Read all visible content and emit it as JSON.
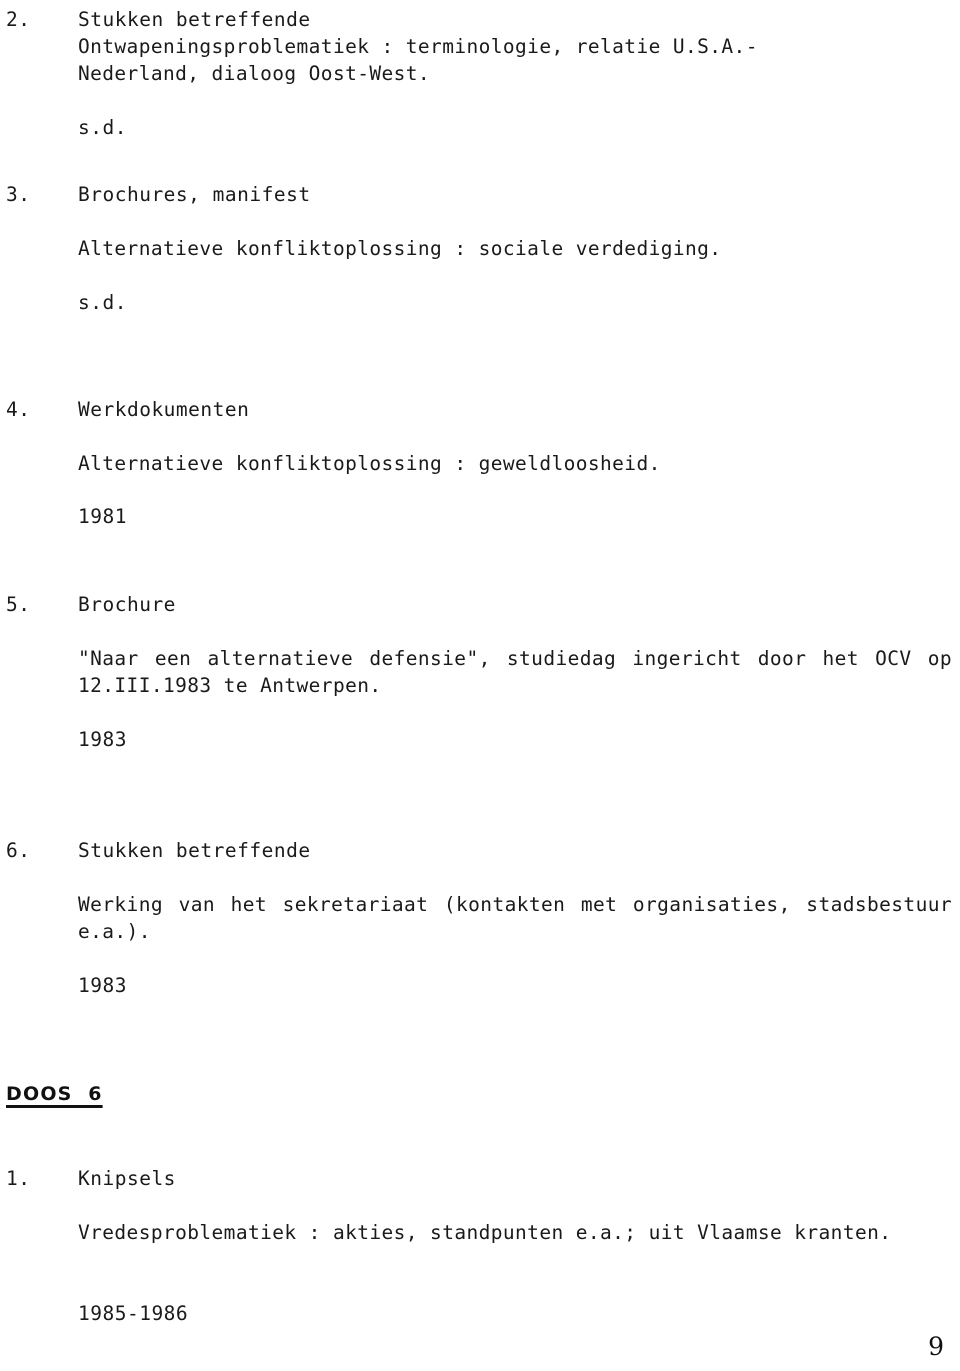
{
  "document": {
    "language": "nl",
    "folio": "9"
  },
  "entries": [
    {
      "number": "2.",
      "title": "Stukken betreffende",
      "description": "Ontwapeningsproblematiek : terminologie, relatie U.S.A.-\nNederland, dialoog Oost-West.",
      "date": "s.d."
    },
    {
      "number": "3.",
      "title": "Brochures, manifest",
      "description": "Alternatieve konfliktoplossing : sociale verdediging.",
      "date": "s.d."
    },
    {
      "number": "4.",
      "title": "Werkdokumenten",
      "description": "Alternatieve konfliktoplossing : geweldloosheid.",
      "date": "1981"
    },
    {
      "number": "5.",
      "title": "Brochure",
      "description": "\"Naar een alternatieve defensie\", studiedag ingericht door het OCV op 12.III.1983 te Antwerpen.",
      "date": "1983"
    },
    {
      "number": "6.",
      "title": "Stukken betreffende",
      "description": "Werking van het sekretariaat (kontakten met organisaties, stadsbestuur e.a.).",
      "date": "1983"
    }
  ],
  "box": {
    "heading": "DOOS  6",
    "entries": [
      {
        "number": "1.",
        "title": "Knipsels",
        "description": "Vredesproblematiek : akties, standpunten e.a.; uit Vlaamse kranten.",
        "date": "1985-1986"
      }
    ]
  }
}
